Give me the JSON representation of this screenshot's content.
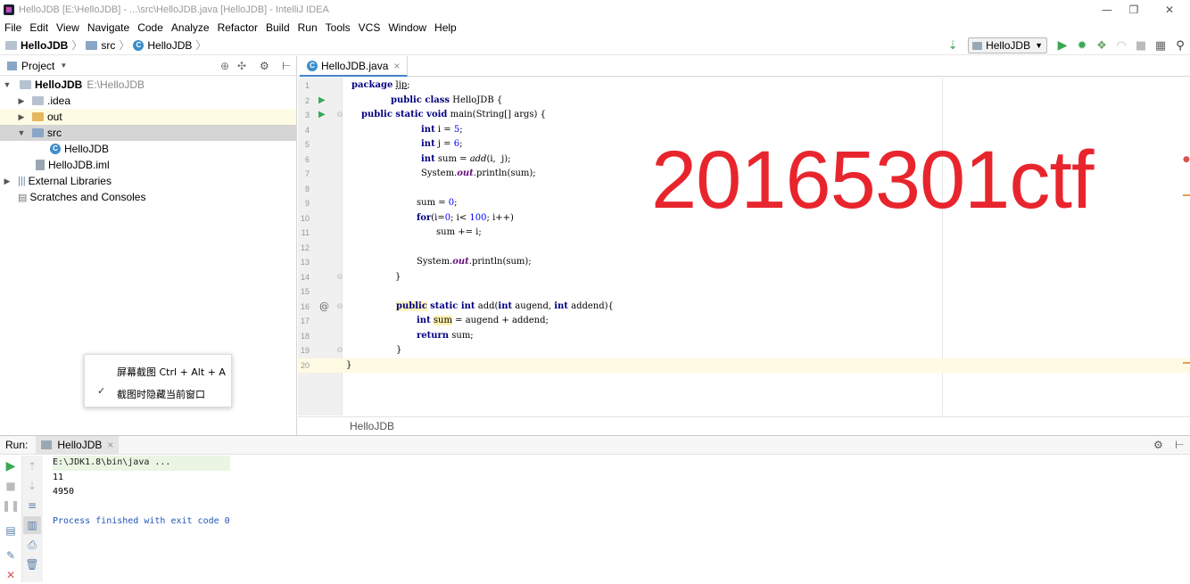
{
  "window": {
    "title": "HelloJDB [E:\\HelloJDB] - ...\\src\\HelloJDB.java [HelloJDB] - IntelliJ IDEA",
    "minimize": "—",
    "maximize": "❐",
    "close": "✕"
  },
  "menu": [
    "File",
    "Edit",
    "View",
    "Navigate",
    "Code",
    "Analyze",
    "Refactor",
    "Build",
    "Run",
    "Tools",
    "VCS",
    "Window",
    "Help"
  ],
  "nav": {
    "crumbs": [
      "HelloJDB",
      "src",
      "HelloJDB"
    ],
    "run_config": "HelloJDB"
  },
  "project": {
    "header": "Project",
    "tree": [
      {
        "label": "HelloJDB",
        "suffix": "E:\\HelloJDB"
      },
      {
        "label": ".idea"
      },
      {
        "label": "out"
      },
      {
        "label": "src"
      },
      {
        "label": "HelloJDB"
      },
      {
        "label": "HelloJDB.iml"
      },
      {
        "label": "External Libraries"
      },
      {
        "label": "Scratches and Consoles"
      }
    ]
  },
  "popup": {
    "item1": "屏幕截图 Ctrl + Alt + A",
    "item2": "截图时隐藏当前窗口",
    "check": "✓"
  },
  "editor": {
    "tab_label": "HelloJDB.java",
    "tab_close": "×",
    "breadcrumb": "HelloJDB",
    "watermark": "20165301ctf",
    "line_numbers": [
      "1",
      "2",
      "3",
      "4",
      "5",
      "6",
      "7",
      "8",
      "9",
      "10",
      "11",
      "12",
      "13",
      "14",
      "15",
      "16",
      "17",
      "18",
      "19",
      "20"
    ]
  },
  "run": {
    "label": "Run:",
    "tab": "HelloJDB",
    "tab_close": "×",
    "console": [
      "E:\\JDK1.8\\bin\\java ...",
      "11",
      "4950",
      "",
      "Process finished with exit code 0"
    ]
  },
  "colors": {
    "accent": "#4083c9",
    "watermark": "#e8252d",
    "run_green": "#3aa853",
    "current_line": "#fffae3"
  }
}
